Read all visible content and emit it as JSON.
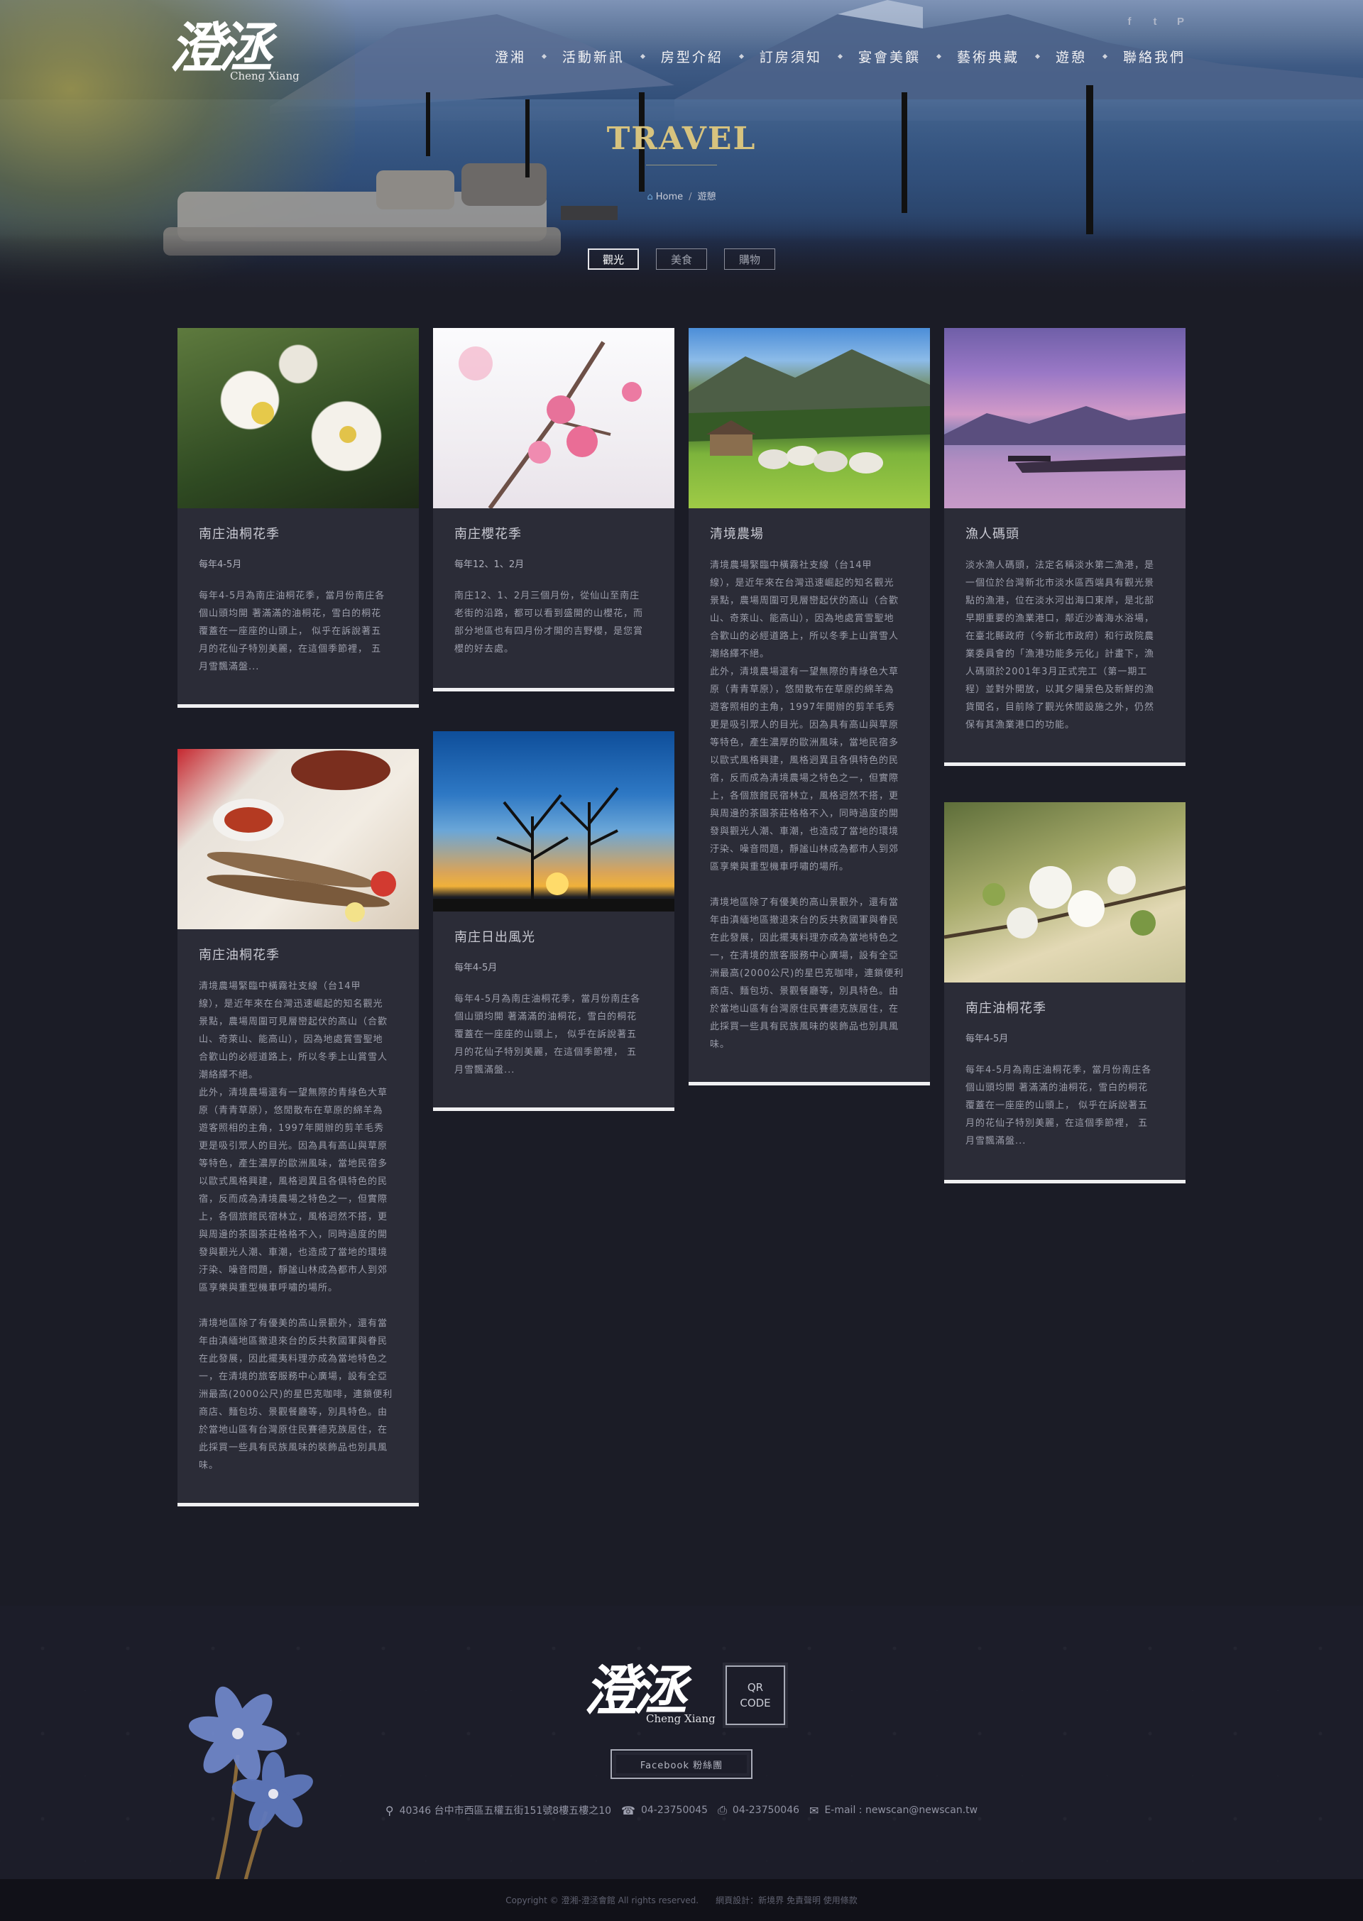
{
  "brand": {
    "logo_mark": "澄洆",
    "logo_sub": "Cheng Xiang"
  },
  "social": {
    "facebook": "f",
    "twitter": "t",
    "plurk": "P"
  },
  "nav": [
    "澄湘",
    "活動新訊",
    "房型介紹",
    "訂房須知",
    "宴會美饌",
    "藝術典藏",
    "遊憩",
    "聯絡我們"
  ],
  "hero": {
    "title": "TRAVEL",
    "breadcrumb_home": "Home",
    "breadcrumb_current": "遊憩"
  },
  "filters": [
    {
      "label": "觀光",
      "active": true
    },
    {
      "label": "美食",
      "active": false
    },
    {
      "label": "購物",
      "active": false
    }
  ],
  "cards": [
    {
      "title": "南庄油桐花季",
      "season": "每年4-5月",
      "desc": "每年4-5月為南庄油桐花季，當月份南庄各\n個山頭均開 著滿滿的油桐花，雪白的桐花\n覆蓋在一座座的山頭上， 似乎在訴說著五\n月的花仙子特別美麗，在這個季節裡， 五\n月雪飄滿盤..."
    },
    {
      "title": "南庄櫻花季",
      "season": "每年12、1、2月",
      "desc": "南庄12、1、2月三個月份，從仙山至南庄\n老街的沿路，都可以看到盛開的山櫻花，而\n部分地區也有四月份才開的吉野櫻，是您賞\n櫻的好去處。"
    },
    {
      "title": "清境農場",
      "desc": "清境農場緊臨中橫霧社支線（台14甲\n線），是近年來在台灣迅速崛起的知名觀光\n景點，農場周圍可見層巒起伏的高山（合歡\n山、奇萊山、能高山），因為地處賞雪聖地\n合歡山的必經道路上，所以冬季上山賞雪人\n潮絡繹不絕。\n此外，清境農場還有一望無際的青綠色大草\n原（青青草原），悠閒散布在草原的綿羊為\n遊客照相的主角，1997年開辦的剪羊毛秀\n更是吸引眾人的目光。因為具有高山與草原\n等特色，產生濃厚的歐洲風味，當地民宿多\n以歐式風格興建，風格迥異且各俱特色的民\n宿，反而成為清境農場之特色之一，但實際\n上，各個旅館民宿林立，風格迥然不搭，更\n與周邊的茶園茶莊格格不入，同時過度的開\n發與觀光人潮、車潮，也造成了當地的環境\n汙染、噪音問題，靜謐山林成為都市人到郊\n區享樂與重型機車呼嘯的場所。\n\n清境地區除了有優美的高山景觀外，還有當\n年由滇緬地區撤退來台的反共救國軍與眷民\n在此發展，因此擺夷料理亦成為當地特色之\n一，在清境的旅客服務中心廣場，設有全亞\n洲最高(2000公尺)的星巴克咖啡，連鎖便利\n商店、麵包坊、景觀餐廳等，別具特色。由\n於當地山區有台灣原住民賽德克族居住，在\n此採買一些具有民族風味的裝飾品也別具風\n味。"
    },
    {
      "title": "漁人碼頭",
      "desc": "淡水漁人碼頭，法定名稱淡水第二漁港，是\n一個位於台灣新北市淡水區西端具有觀光景\n點的漁港，位在淡水河出海口東岸，是北部\n早期重要的漁業港口，鄰近沙崙海水浴場，\n在臺北縣政府（今新北市政府）和行政院農\n業委員會的「漁港功能多元化」計畫下，漁\n人碼頭於2001年3月正式完工（第一期工\n程）並對外開放，以其夕陽景色及新鮮的漁\n貨聞名，目前除了觀光休閒設施之外，仍然\n保有其漁業港口的功能。"
    },
    {
      "title": "南庄油桐花季",
      "desc": "清境農場緊臨中橫霧社支線（台14甲\n線），是近年來在台灣迅速崛起的知名觀光\n景點，農場周圍可見層巒起伏的高山（合歡\n山、奇萊山、能高山），因為地處賞雪聖地\n合歡山的必經道路上，所以冬季上山賞雪人\n潮絡繹不絕。\n此外，清境農場還有一望無際的青綠色大草\n原（青青草原），悠閒散布在草原的綿羊為\n遊客照相的主角，1997年開辦的剪羊毛秀\n更是吸引眾人的目光。因為具有高山與草原\n等特色，產生濃厚的歐洲風味，當地民宿多\n以歐式風格興建，風格迥異且各俱特色的民\n宿，反而成為清境農場之特色之一，但實際\n上，各個旅館民宿林立，風格迥然不搭，更\n與周邊的茶園茶莊格格不入，同時過度的開\n發與觀光人潮、車潮，也造成了當地的環境\n汙染、噪音問題，靜謐山林成為都市人到郊\n區享樂與重型機車呼嘯的場所。\n\n清境地區除了有優美的高山景觀外，還有當\n年由滇緬地區撤退來台的反共救國軍與眷民\n在此發展，因此擺夷料理亦成為當地特色之\n一，在清境的旅客服務中心廣場，設有全亞\n洲最高(2000公尺)的星巴克咖啡，連鎖便利\n商店、麵包坊、景觀餐廳等，別具特色。由\n於當地山區有台灣原住民賽德克族居住，在\n此採買一些具有民族風味的裝飾品也別具風\n味。"
    },
    {
      "title": "南庄日出風光",
      "season": "每年4-5月",
      "desc": "每年4-5月為南庄油桐花季，當月份南庄各\n個山頭均開 著滿滿的油桐花，雪白的桐花\n覆蓋在一座座的山頭上， 似乎在訴說著五\n月的花仙子特別美麗，在這個季節裡， 五\n月雪飄滿盤..."
    },
    {
      "title": "南庄油桐花季",
      "season": "每年4-5月",
      "desc": "每年4-5月為南庄油桐花季，當月份南庄各\n個山頭均開 著滿滿的油桐花，雪白的桐花\n覆蓋在一座座的山頭上， 似乎在訴說著五\n月的花仙子特別美麗，在這個季節裡， 五\n月雪飄滿盤..."
    }
  ],
  "footer": {
    "logo_mark": "澄洆",
    "logo_sub": "Cheng Xiang",
    "qr_line1": "QR",
    "qr_line2": "CODE",
    "facebook_btn": "Facebook 粉絲團",
    "address": "40346 台中市西區五權五街151號8樓五樓之10",
    "tel": "04-23750045",
    "fax": "04-23750046",
    "email": "E-mail : newscan@newscan.tw",
    "copyright": "Copyright © 澄湘-澄洆會館 All rights reserved.",
    "credits": "網頁設計：新境界  免責聲明  使用條款"
  },
  "colors": {
    "accent_gold": "#d7c37e",
    "background": "#1b1c26",
    "card": "#2b2c37"
  }
}
